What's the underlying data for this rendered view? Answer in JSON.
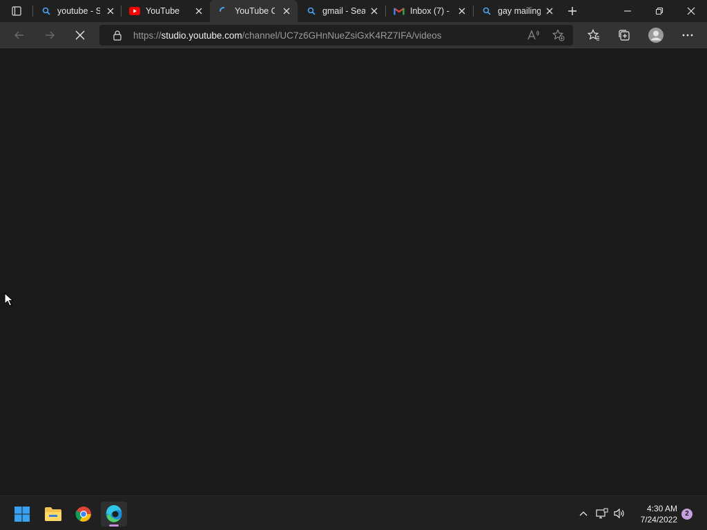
{
  "browser": {
    "tabs": [
      {
        "title": "youtube - S",
        "favicon": "search-icon"
      },
      {
        "title": "YouTube",
        "favicon": "youtube-icon"
      },
      {
        "title": "YouTube C",
        "favicon": "loading-spinner-icon",
        "active": true
      },
      {
        "title": "gmail - Sea",
        "favicon": "search-icon"
      },
      {
        "title": "Inbox (7) - ",
        "favicon": "gmail-icon"
      },
      {
        "title": "gay mailing",
        "favicon": "search-icon"
      }
    ],
    "address": {
      "prefix": "https://",
      "host": "studio.youtube.com",
      "path": "/channel/UC7z6GHnNueZsiGxK4RZ7IFA/videos"
    }
  },
  "taskbar": {
    "apps": [
      "windows-start-icon",
      "file-explorer-icon",
      "chrome-icon",
      "edge-icon"
    ],
    "time": "4:30 AM",
    "date": "7/24/2022",
    "notification_count": "2"
  },
  "colors": {
    "accent": "#c98fd8",
    "youtube_red": "#ff0000",
    "search_blue": "#4aa3f0"
  }
}
